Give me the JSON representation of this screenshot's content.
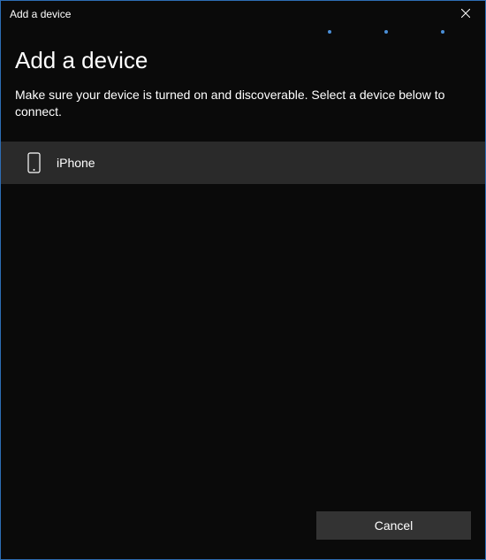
{
  "titlebar": {
    "title": "Add a device"
  },
  "content": {
    "heading": "Add a device",
    "description": "Make sure your device is turned on and discoverable. Select a device below to connect."
  },
  "devices": [
    {
      "name": "iPhone",
      "icon": "phone-icon"
    }
  ],
  "footer": {
    "cancel_label": "Cancel"
  }
}
